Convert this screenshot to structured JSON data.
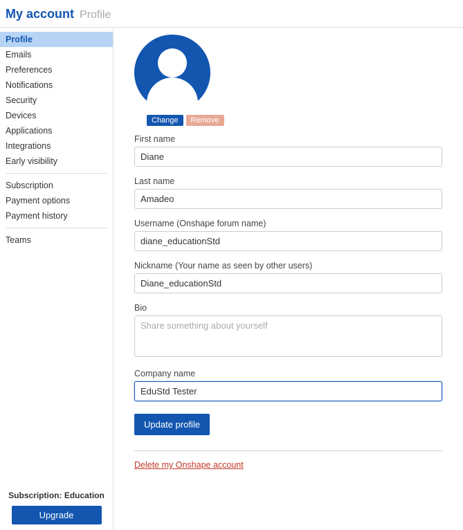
{
  "header": {
    "title": "My account",
    "crumb": "Profile"
  },
  "sidebar": {
    "groups": [
      {
        "items": [
          {
            "label": "Profile",
            "active": true
          },
          {
            "label": "Emails"
          },
          {
            "label": "Preferences"
          },
          {
            "label": "Notifications"
          },
          {
            "label": "Security"
          },
          {
            "label": "Devices"
          },
          {
            "label": "Applications"
          },
          {
            "label": "Integrations"
          },
          {
            "label": "Early visibility"
          }
        ]
      },
      {
        "items": [
          {
            "label": "Subscription"
          },
          {
            "label": "Payment options"
          },
          {
            "label": "Payment history"
          }
        ]
      },
      {
        "items": [
          {
            "label": "Teams"
          }
        ]
      }
    ],
    "subscription_label": "Subscription: Education",
    "upgrade_label": "Upgrade"
  },
  "avatar_buttons": {
    "change": "Change",
    "remove": "Remove"
  },
  "fields": {
    "first_name": {
      "label": "First name",
      "value": "Diane"
    },
    "last_name": {
      "label": "Last name",
      "value": "Amadeo"
    },
    "username": {
      "label": "Username (Onshape forum name)",
      "value": "diane_educationStd"
    },
    "nickname": {
      "label": "Nickname (Your name as seen by other users)",
      "value": "Diane_educationStd"
    },
    "bio": {
      "label": "Bio",
      "placeholder": "Share something about yourself",
      "value": ""
    },
    "company": {
      "label": "Company name",
      "value": "EduStd Tester"
    }
  },
  "update_label": "Update profile",
  "delete_link": "Delete my Onshape account"
}
